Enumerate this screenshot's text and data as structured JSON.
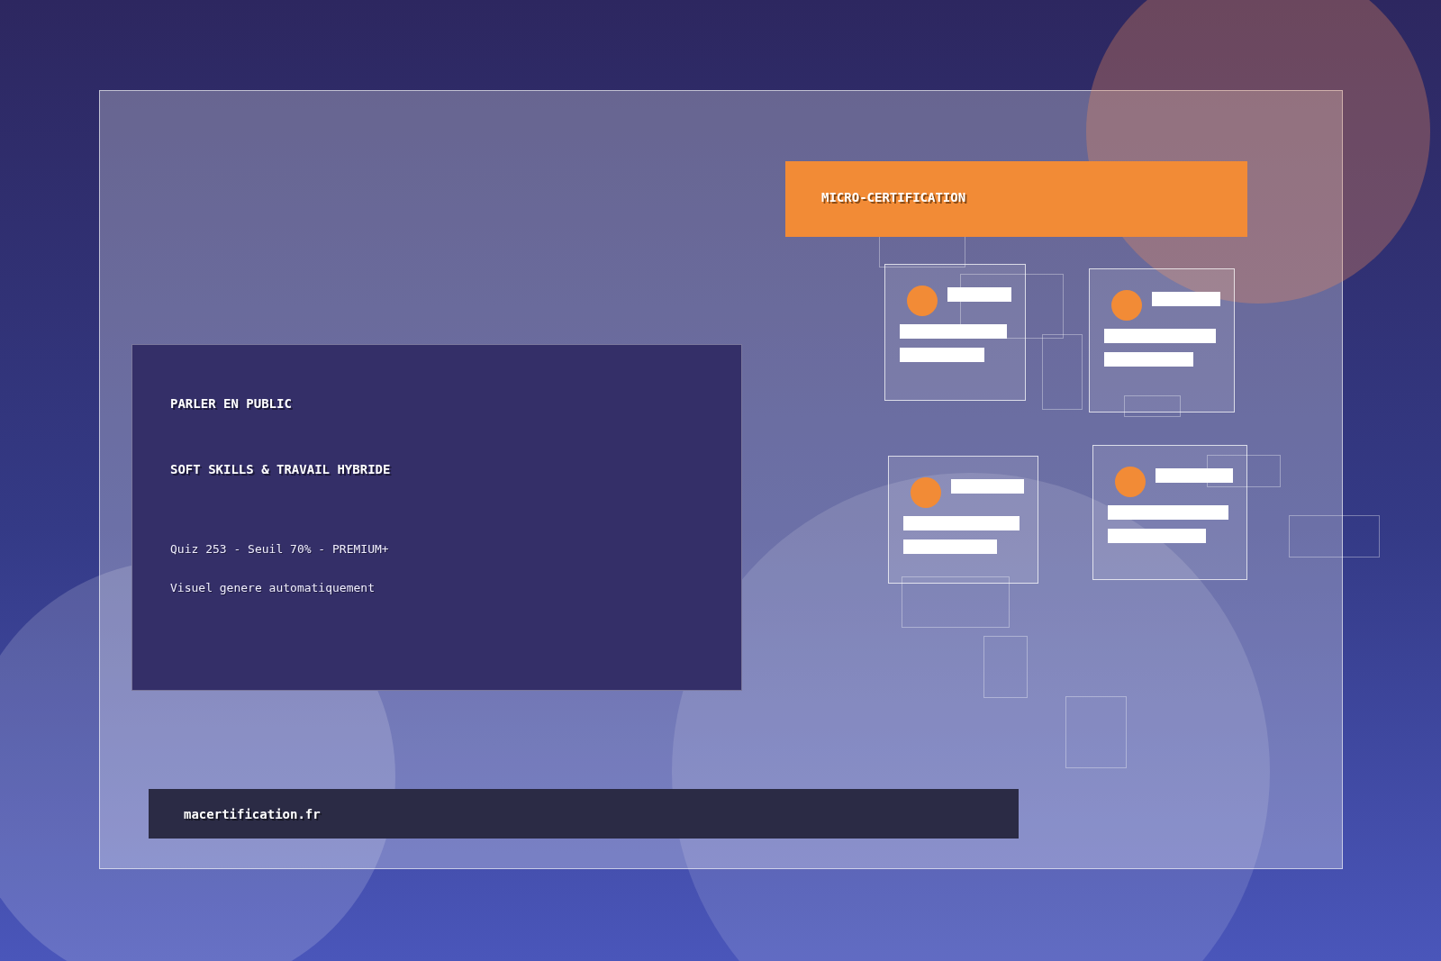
{
  "badge": {
    "label": "MICRO-CERTIFICATION"
  },
  "panel": {
    "title": "PARLER EN PUBLIC",
    "subtitle": "SOFT SKILLS & TRAVAIL HYBRIDE",
    "meta": "Quiz 253 - Seuil 70% - PREMIUM+",
    "note": "Visuel genere automatiquement"
  },
  "footer": {
    "url": "macertification.fr"
  }
}
